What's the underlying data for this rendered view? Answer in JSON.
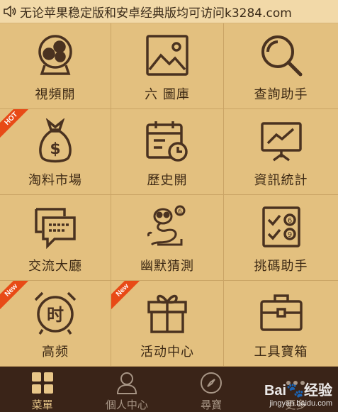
{
  "notice": {
    "icon": "speaker-icon",
    "text": "无论苹果稳定版和安卓经典版均可访问k3284.com"
  },
  "grid": [
    {
      "label": "視頻開",
      "icon": "lottery-balls-icon",
      "badge": ""
    },
    {
      "label": "六   圖庫",
      "icon": "picture-icon",
      "badge": ""
    },
    {
      "label": "查詢助手",
      "icon": "magnifier-icon",
      "badge": ""
    },
    {
      "label": "淘料市場",
      "icon": "money-bag-icon",
      "badge": "HOT"
    },
    {
      "label": "歷史開",
      "icon": "calendar-clock-icon",
      "badge": ""
    },
    {
      "label": "資訊統計",
      "icon": "trend-board-icon",
      "badge": ""
    },
    {
      "label": "交流大廳",
      "icon": "chat-bubbles-icon",
      "badge": ""
    },
    {
      "label": "幽默猜測",
      "icon": "snake-icon",
      "badge": ""
    },
    {
      "label": "挑碼助手",
      "icon": "checklist-icon",
      "badge": ""
    },
    {
      "label": "高频",
      "icon": "alarm-clock-icon",
      "badge": "New"
    },
    {
      "label": "活动中心",
      "icon": "gift-icon",
      "badge": "New"
    },
    {
      "label": "工具寶箱",
      "icon": "toolbox-icon",
      "badge": ""
    }
  ],
  "alarm_glyph": "时",
  "tabs": [
    {
      "label": "菜單",
      "icon": "menu-grid-icon",
      "active": true
    },
    {
      "label": "個人中心",
      "icon": "person-icon",
      "active": false
    },
    {
      "label": "尋寶",
      "icon": "compass-icon",
      "active": false
    },
    {
      "label": "更多",
      "icon": "more-icon",
      "active": false
    }
  ],
  "watermark": {
    "brand": "Bai",
    "sub": "经验",
    "url": "jingyan.baidu.com"
  },
  "colors": {
    "accent": "#e8c688",
    "badge": "#e84a16",
    "icon": "#4a3220",
    "tabbar": "#3a2418"
  }
}
